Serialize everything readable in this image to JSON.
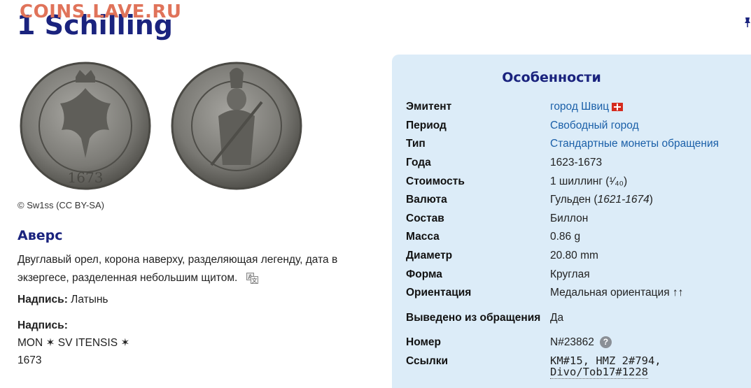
{
  "watermark": "COINS.LAVE.RU",
  "title": "1 Schilling",
  "image_credit": "© Sw1ss (CC BY-SA)",
  "obverse": {
    "heading": "Аверс",
    "description": "Двуглавый орел, корона наверху, разделяющая легенду, дата в экзергесе, разделенная небольшим щитом.",
    "script_label": "Надпись:",
    "script_value": "Латынь",
    "lettering_label": "Надпись:",
    "lettering_line1": "MON ✶ SV ITENSIS ✶",
    "lettering_line2": "1673"
  },
  "features": {
    "title": "Особенности",
    "rows": [
      {
        "key": "Эмитент",
        "value": "город Швиц"
      },
      {
        "key": "Период",
        "value": "Свободный город"
      },
      {
        "key": "Тип",
        "value": "Стандартные монеты обращения"
      },
      {
        "key": "Года",
        "value": "1623-1673"
      },
      {
        "key": "Стоимость",
        "value": "1 шиллинг (¹⁄₄₀)"
      },
      {
        "key": "Валюта",
        "value": "Гульден",
        "value_extra": "1621-1674"
      },
      {
        "key": "Состав",
        "value": "Биллон"
      },
      {
        "key": "Масса",
        "value": "0.86 g"
      },
      {
        "key": "Диаметр",
        "value": "20.80 mm"
      },
      {
        "key": "Форма",
        "value": "Круглая"
      },
      {
        "key": "Ориентация",
        "value": "Медальная ориентация ↑↑"
      },
      {
        "key": "Выведено из обращения",
        "value": "Да"
      },
      {
        "key": "Номер",
        "value": "N#23862"
      },
      {
        "key": "Ссылки",
        "value": "KM#15, HMZ 2#794,",
        "value_line2": "Divo/Tob17#1228"
      }
    ]
  },
  "icons": {
    "flag": "swiss-flag-icon",
    "help": "help-icon",
    "translate": "translate-icon"
  },
  "colors": {
    "title": "#1a237e",
    "link": "#1a5fa8",
    "panel_bg": "#dcecf8",
    "watermark": "#e0735a"
  }
}
